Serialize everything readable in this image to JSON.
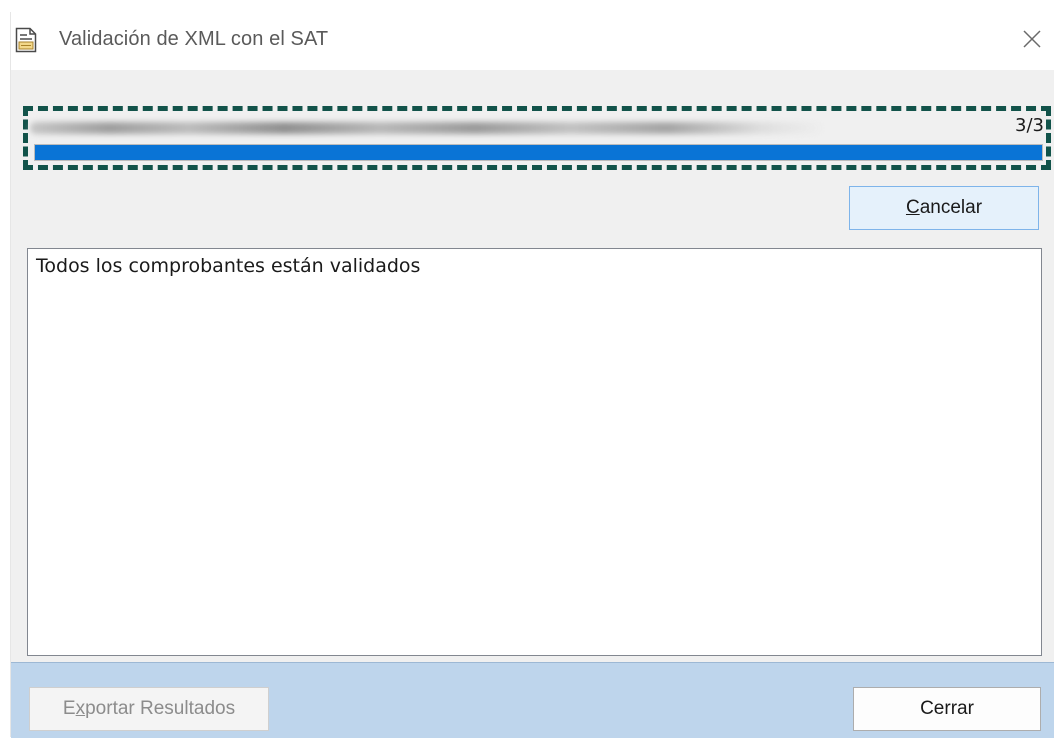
{
  "window": {
    "title": "Validación de XML con el SAT",
    "title_icon": "xml-document-icon",
    "close_icon": "close-icon"
  },
  "progress": {
    "counter": "3/3",
    "value": 1.0,
    "fill_color": "#0a74d6",
    "highlight_color": "#12534a"
  },
  "buttons": {
    "cancel": {
      "mnemonic": "C",
      "rest": "ancelar"
    },
    "export": {
      "before": "E",
      "mnemonic": "x",
      "rest": "portar Resultados"
    },
    "close": "Cerrar"
  },
  "results": {
    "text": "Todos los comprobantes están validados"
  },
  "colors": {
    "footer_bg": "#bed5ec",
    "window_bg": "#f0f0f0"
  }
}
